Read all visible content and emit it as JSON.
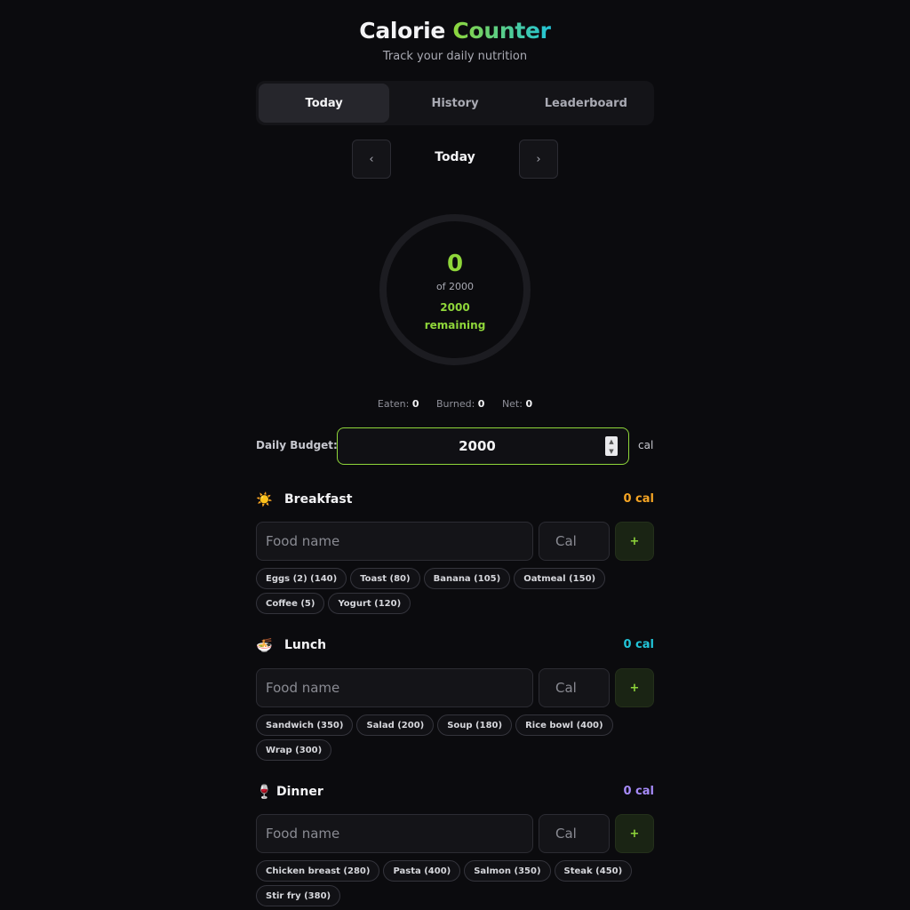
{
  "header": {
    "title_main": "Calorie",
    "title_accent": "Counter",
    "subtitle": "Track your daily nutrition"
  },
  "tabs": [
    {
      "label": "Today",
      "active": true
    },
    {
      "label": "History",
      "active": false
    },
    {
      "label": "Leaderboard",
      "active": false
    }
  ],
  "date_nav": {
    "prev_label": "‹",
    "label": "Today",
    "next_label": "›"
  },
  "summary": {
    "consumed": "0",
    "of_text": "of 2000",
    "remaining_value": "2000",
    "remaining_label": "remaining",
    "progress_fraction": 0
  },
  "stats": {
    "eaten_label": "Eaten:",
    "eaten_value": "0",
    "burned_label": "Burned:",
    "burned_value": "0",
    "net_label": "Net:",
    "net_value": "0"
  },
  "budget": {
    "label": "Daily Budget:",
    "value": "2000",
    "unit": "cal"
  },
  "meals": [
    {
      "name": "Breakfast",
      "icon": "☀️",
      "total": "0 cal",
      "color": "#f5a524",
      "food_placeholder": "Food name",
      "cal_placeholder": "Cal",
      "add_label": "+",
      "suggestions": [
        "Eggs (2) (140)",
        "Toast (80)",
        "Banana (105)",
        "Oatmeal (150)",
        "Coffee (5)",
        "Yogurt (120)"
      ]
    },
    {
      "name": "Lunch",
      "icon": "🍜",
      "total": "0 cal",
      "color": "#22c4d8",
      "food_placeholder": "Food name",
      "cal_placeholder": "Cal",
      "add_label": "+",
      "suggestions": [
        "Sandwich (350)",
        "Salad (200)",
        "Soup (180)",
        "Rice bowl (400)",
        "Wrap (300)"
      ]
    },
    {
      "name": "Dinner",
      "icon": "🍷",
      "total": "0 cal",
      "color": "#a78bfa",
      "food_placeholder": "Food name",
      "cal_placeholder": "Cal",
      "add_label": "+",
      "suggestions": [
        "Chicken breast (280)",
        "Pasta (400)",
        "Salmon (350)",
        "Steak (450)",
        "Stir fry (380)"
      ]
    }
  ],
  "colors": {
    "accent_green": "#8fd63a",
    "accent_cyan": "#22c4d8",
    "background": "#0b0b0e"
  }
}
